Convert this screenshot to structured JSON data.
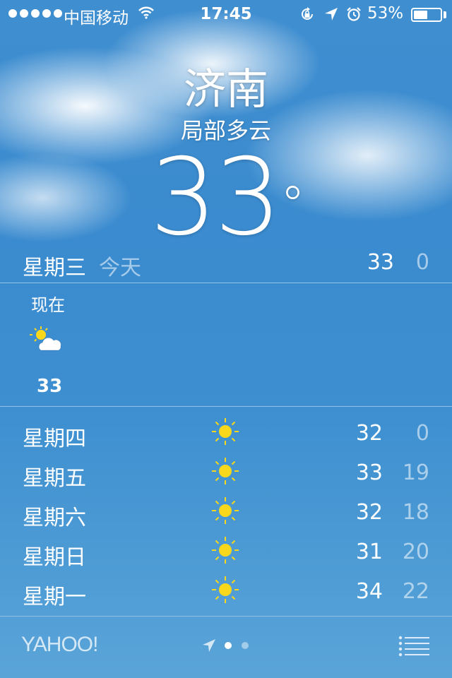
{
  "status_bar": {
    "carrier": "中国移动",
    "time": "17:45",
    "battery_percent": "53%",
    "battery_level": 0.53,
    "icons": [
      "signal-dots",
      "wifi-icon",
      "rotation-lock-icon",
      "location-icon",
      "alarm-icon",
      "battery-icon"
    ]
  },
  "header": {
    "city": "济南",
    "condition": "局部多云",
    "temperature": "33",
    "degree": "°"
  },
  "today": {
    "day": "星期三",
    "label": "今天",
    "high": "33",
    "low": "0"
  },
  "hourly": [
    {
      "time": "现在",
      "icon": "partly-cloudy-icon",
      "temp": "33"
    }
  ],
  "forecast": [
    {
      "day": "星期四",
      "icon": "sun-icon",
      "high": "32",
      "low": "0"
    },
    {
      "day": "星期五",
      "icon": "sun-icon",
      "high": "33",
      "low": "19"
    },
    {
      "day": "星期六",
      "icon": "sun-icon",
      "high": "32",
      "low": "18"
    },
    {
      "day": "星期日",
      "icon": "sun-icon",
      "high": "31",
      "low": "20"
    },
    {
      "day": "星期一",
      "icon": "sun-icon",
      "high": "34",
      "low": "22"
    }
  ],
  "footer": {
    "logo": "YAHOO!",
    "page_count": 2,
    "active_page": 1
  },
  "colors": {
    "sky_blue": "#3d8fd0",
    "sun_yellow": "#f9d81b"
  }
}
